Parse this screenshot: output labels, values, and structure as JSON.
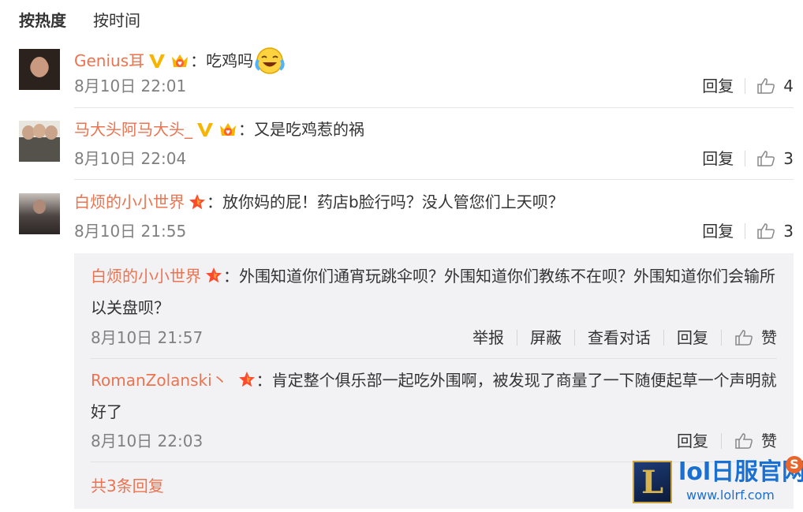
{
  "sort": {
    "hot": "按热度",
    "time": "按时间"
  },
  "comments": [
    {
      "username": "Genius耳",
      "text": "：吃鸡吗",
      "time": "8月10日 22:01",
      "reply_label": "回复",
      "likes": "4",
      "badges": [
        "vip-v-icon",
        "crown-icon"
      ],
      "emoji": "laughing-crying-emoji"
    },
    {
      "username": "马大头阿马大头_",
      "text": "：又是吃鸡惹的祸",
      "time": "8月10日 22:04",
      "reply_label": "回复",
      "likes": "3",
      "badges": [
        "vip-v-icon",
        "crown-icon"
      ]
    },
    {
      "username": "白烦的小小世界",
      "text": "：放你妈的屁！药店b脸行吗？没人管您们上天呗？",
      "time": "8月10日 21:55",
      "reply_label": "回复",
      "likes": "3",
      "badges": [
        "star-icon"
      ]
    }
  ],
  "replies": [
    {
      "username": "白烦的小小世界",
      "text": "：外围知道你们通宵玩跳伞呗？外围知道你们教练不在呗？外围知道你们会输所以关盘呗？",
      "time": "8月10日 21:57",
      "actions": [
        "举报",
        "屏蔽",
        "查看对话",
        "回复"
      ],
      "like_label": "赞"
    },
    {
      "username": "RomanZolanski丶",
      "text": "：肯定整个俱乐部一起吃外围啊，被发现了商量了一下随便起草一个声明就好了",
      "time": "8月10日 22:03",
      "actions": [
        "回复"
      ],
      "like_label": "赞"
    }
  ],
  "total_replies": "共3条回复",
  "watermark": {
    "title": "lol日服官网",
    "url": "www.lolrf.com",
    "logo_letter": "L",
    "badge_letter": "S"
  },
  "colors": {
    "username": "#eb7350",
    "meta": "#808080",
    "reply_bg": "#f2f2f5",
    "watermark": "#1a6fd1"
  }
}
